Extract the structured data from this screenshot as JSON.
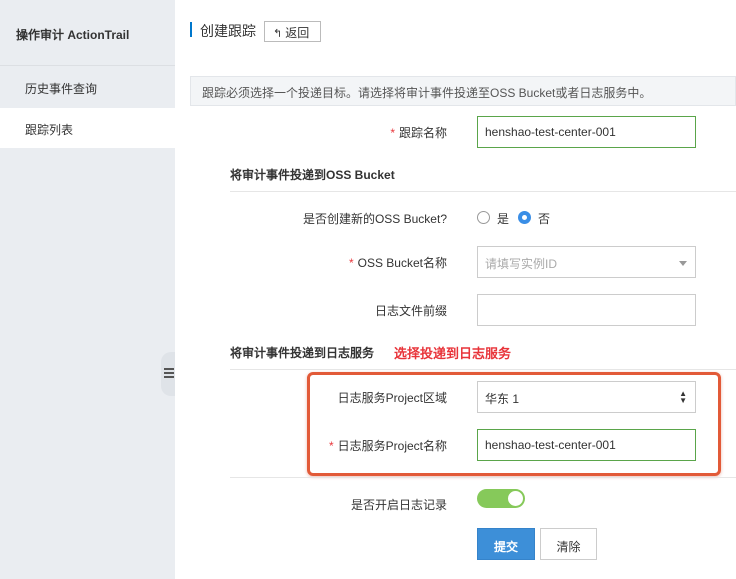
{
  "sidebar": {
    "title": "操作审计 ActionTrail",
    "items": [
      {
        "label": "历史事件查询"
      },
      {
        "label": "跟踪列表"
      }
    ]
  },
  "header": {
    "title": "创建跟踪",
    "back_icon": "↰",
    "back_label": "返回"
  },
  "notice": "跟踪必须选择一个投递目标。请选择将审计事件投递至OSS Bucket或者日志服务中。",
  "form": {
    "required_mark": "*",
    "trail_name": {
      "label": "跟踪名称",
      "value": "henshao-test-center-001"
    },
    "oss_section": "将审计事件投递到OSS Bucket",
    "create_bucket": {
      "label": "是否创建新的OSS Bucket?",
      "yes": "是",
      "no": "否",
      "selected": "no"
    },
    "bucket_name": {
      "label": "OSS Bucket名称",
      "placeholder": "请填写实例ID"
    },
    "log_prefix": {
      "label": "日志文件前缀",
      "value": ""
    },
    "sls_section": "将审计事件投递到日志服务",
    "sls_annotation": "选择投递到日志服务",
    "sls_region": {
      "label": "日志服务Project区域",
      "value": "华东 1"
    },
    "sls_project": {
      "label": "日志服务Project名称",
      "value": "henshao-test-center-001"
    },
    "enable_logging": {
      "label": "是否开启日志记录",
      "on": true
    },
    "submit_label": "提交",
    "clear_label": "清除"
  },
  "colors": {
    "accent": "#3d8fd8",
    "toggle_on": "#86c95a",
    "annotation": "#e25a38"
  }
}
